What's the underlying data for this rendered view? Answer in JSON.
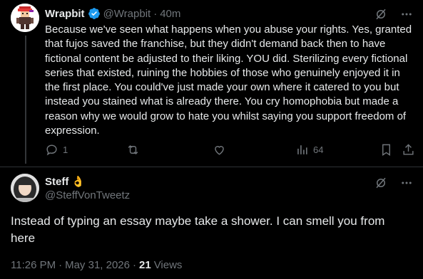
{
  "colors": {
    "background": "#000000",
    "text": "#e7e9ea",
    "muted": "#71767b",
    "verified": "#1d9bf0",
    "divider": "#2f3336"
  },
  "tweet1": {
    "display_name": "Wrapbit",
    "handle": "@Wrapbit",
    "separator": "·",
    "time": "40m",
    "verified_icon": "verified-badge-icon",
    "text": "Because we've seen what happens when you abuse your rights. Yes, granted that fujos saved the franchise, but they didn't demand back then to have fictional content be adjusted to their liking. YOU did. Sterilizing every fictional series that existed, ruining the hobbies of those who genuinely enjoyed it in the first place. You could've just made your own where it catered to you but instead you stained what is already there. You cry homophobia but made a reason why we would grow to hate you whilst saying you support freedom of expression.",
    "actions": {
      "reply_count": "1",
      "retweet_count": "",
      "like_count": "",
      "views_count": "64"
    }
  },
  "tweet2": {
    "display_name": "Steff",
    "name_emoji": "👌",
    "handle": "@SteffVonTweetz",
    "text": "Instead of typing an essay maybe take a shower. I can smell you from here",
    "time": "11:26 PM",
    "sep1": "·",
    "date": "May 31, 2026",
    "sep2": "·",
    "views_count": "21",
    "views_label": "Views"
  }
}
